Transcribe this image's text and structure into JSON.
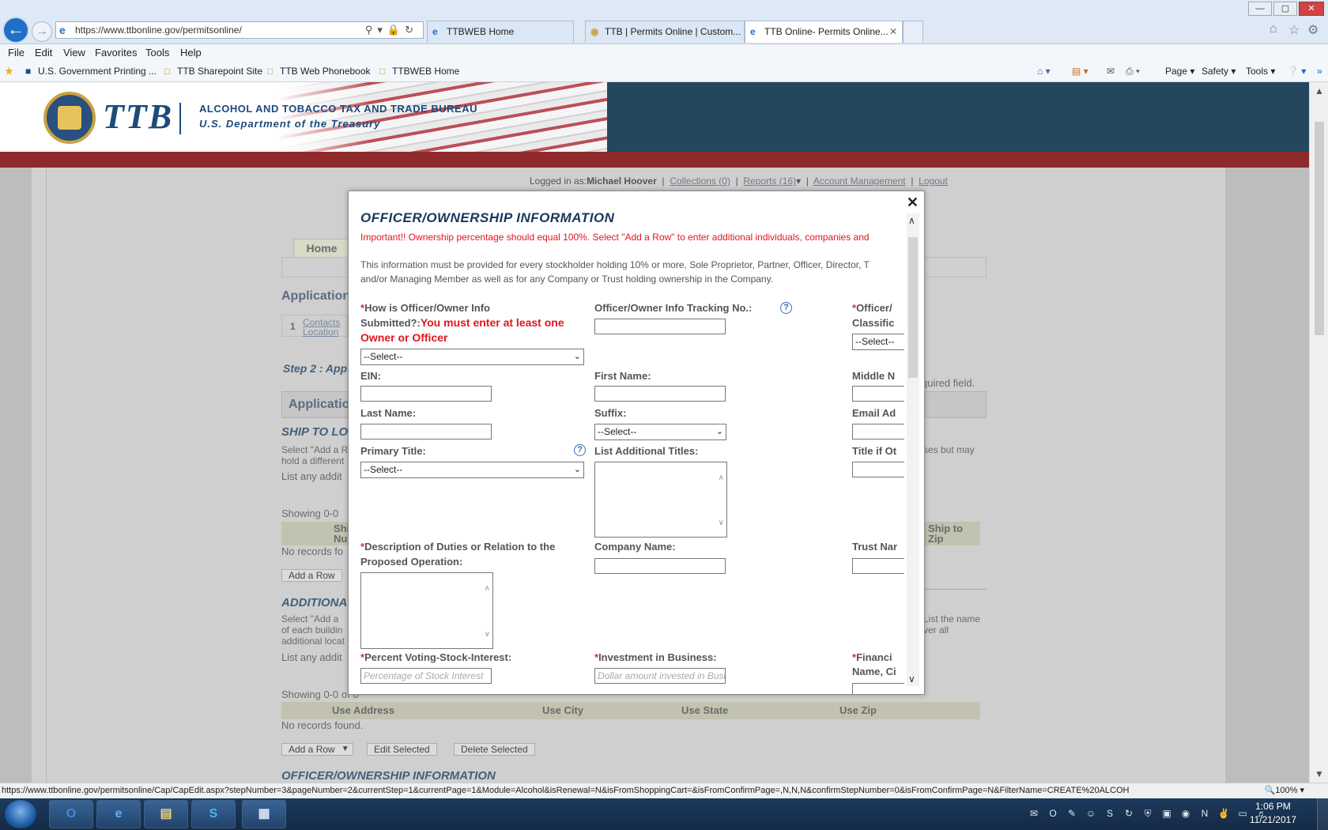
{
  "browser": {
    "address_url": "https://www.ttbonline.gov/permitsonline/",
    "address_domain": "ttbonline.gov",
    "tabs": [
      {
        "label": "TTBWEB Home"
      },
      {
        "label": "TTB | Permits Online | Custom..."
      },
      {
        "label": "TTB Online- Permits Online...",
        "active": true
      }
    ],
    "menu": [
      "File",
      "Edit",
      "View",
      "Favorites",
      "Tools",
      "Help"
    ],
    "favorites": [
      "U.S. Government Printing ...",
      "TTB Sharepoint Site",
      "TTB Web Phonebook",
      "TTBWEB Home"
    ],
    "commands": [
      "Page",
      "Safety",
      "Tools"
    ],
    "status_url": "https://www.ttbonline.gov/permitsonline/Cap/CapEdit.aspx?stepNumber=3&pageNumber=2&currentStep=1&currentPage=1&Module=Alcohol&isRenewal=N&isFromShoppingCart=&isFromConfirmPage=,N,N,N&confirmStepNumber=0&isFromConfirmPage=N&FilterName=CREATE%20ALCOH",
    "zoom": "100%",
    "icons": [
      "back-arrow-icon",
      "forward-arrow-icon",
      "home-icon",
      "star-icon",
      "gear-icon"
    ]
  },
  "site": {
    "logo_text": "TTB",
    "bureau_name": "ALCOHOL AND TOBACCO TAX AND TRADE BUREAU",
    "treasury_name": "U.S. Department of the Treasury",
    "colors": {
      "header_blue": "#24465f",
      "band_red": "#8e2a2c"
    }
  },
  "user_bar": {
    "logged_in_label": "Logged in as:",
    "user_name": "Michael Hoover",
    "links": [
      "Collections (0)",
      "Reports (16)",
      "Account Management",
      "Logout"
    ]
  },
  "background_page": {
    "home_tab": "Home",
    "application_heading": "Application",
    "step_number": "1",
    "step_links": [
      "Contacts",
      "Location"
    ],
    "step2_text": "Step 2 : App",
    "required_note": "quired field.",
    "application_bar": "Application",
    "ship_to_heading": "SHIP TO LO",
    "ship_to_desc_1": "Select \"Add a R",
    "ship_to_desc_2": "hold a different",
    "ship_to_desc_right": "ses but may",
    "list_any_addi": "List any addit",
    "showing": "Showing 0-0",
    "ship_col": "Shi",
    "num_col": "Nu",
    "ship_to_zip": "Ship to",
    "zip": "Zip",
    "no_records": "No records fo",
    "add_row": "Add a Row",
    "additional_heading": "ADDITIONA",
    "addl_desc_1": "Select \"Add a",
    "addl_desc_2": "of each buildin",
    "addl_desc_3": "additional locat",
    "addl_right_1": "List the name",
    "addl_right_2": "ver all",
    "list_any_addi2": "List any addit",
    "showing2": "Showing 0-0 of 0",
    "use_columns": [
      "Use Address",
      "Use City",
      "Use State",
      "Use Zip"
    ],
    "no_records_found": "No records found.",
    "buttons": [
      "Add a Row",
      "Edit Selected",
      "Delete Selected"
    ],
    "officer_heading": "OFFICER/OWNERSHIP INFORMATION"
  },
  "modal": {
    "title": "OFFICER/OWNERSHIP INFORMATION",
    "important": "Important!! Ownership percentage should equal 100%. Select \"Add a Row\" to enter additional individuals, companies and",
    "info_line_1": "This information must be provided for every stockholder holding 10% or more, Sole Proprietor, Partner, Officer, Director, T",
    "info_line_2": "and/or Managing Member as well as for any Company or Trust holding ownership in the Company.",
    "fields": {
      "how_submitted_1": "How is Officer/Owner Info",
      "how_submitted_2": "Submitted?:",
      "how_submitted_err_1": "You must enter at least one",
      "how_submitted_err_2": "Owner or Officer",
      "tracking_no": "Officer/Owner Info Tracking No.:",
      "classification_1": "Officer/",
      "classification_2": "Classific",
      "ein": "EIN:",
      "first_name": "First Name:",
      "middle_name": "Middle N",
      "last_name": "Last Name:",
      "suffix": "Suffix:",
      "email": "Email Ad",
      "primary_title": "Primary Title:",
      "additional_titles": "List Additional Titles:",
      "title_if_other": "Title if Ot",
      "description_1": "Description of Duties or Relation to the",
      "description_2": "Proposed Operation:",
      "company_name": "Company Name:",
      "trust_name": "Trust Nar",
      "percent_voting": "Percent Voting-Stock-Interest:",
      "investment": "Investment in Business:",
      "financial_1": "Financi",
      "financial_2": "Name, Ci"
    },
    "select_default": "--Select--",
    "select_cut": "--Select--",
    "placeholders": {
      "percent": "Percentage of Stock Interest",
      "investment": "Dollar amount invested in Business"
    }
  },
  "taskbar": {
    "clock_time": "1:06 PM",
    "clock_date": "11/21/2017",
    "apps": [
      "outlook-icon",
      "internet-explorer-icon",
      "file-explorer-icon",
      "skype-icon",
      "app-window-icon"
    ]
  }
}
